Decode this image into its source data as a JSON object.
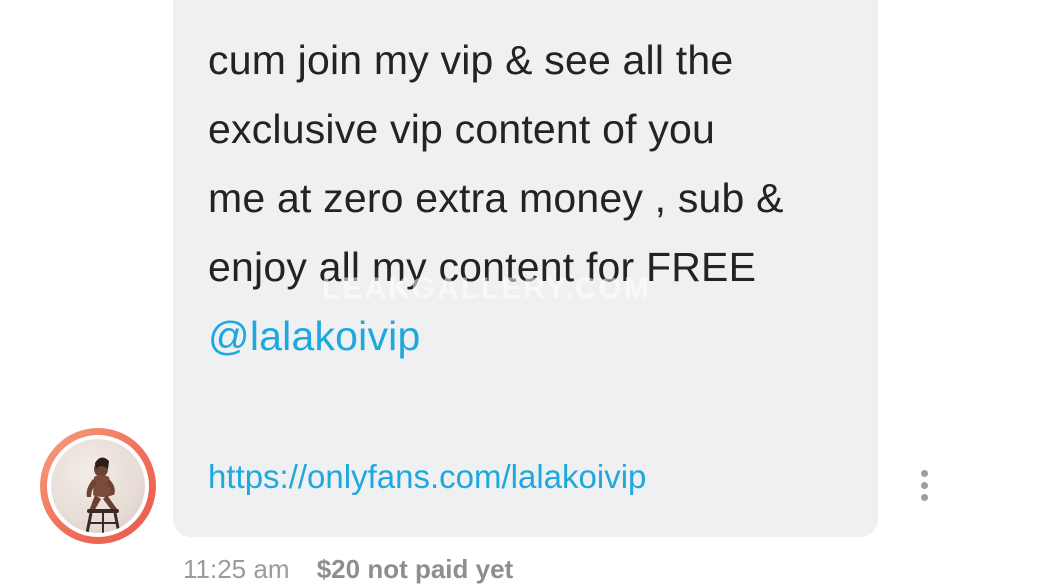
{
  "message": {
    "lines": [
      "cum join my vip & see all the",
      "exclusive vip content of you",
      "me at zero extra money , sub &",
      "enjoy all my content for FREE"
    ],
    "mention": "@lalakoivip",
    "link": "https://onlyfans.com/lalakoivip",
    "watermark": "LEAKGALLERY.COM"
  },
  "meta": {
    "time": "11:25 am",
    "price_status": "$20 not paid yet"
  },
  "icons": {
    "menu": "more-vertical-icon",
    "avatar": "avatar"
  },
  "colors": {
    "bubble": "#eff0f2",
    "text": "#222325",
    "link": "#1fa8de",
    "avatar_ring": "#ef6f5a",
    "meta": "#9a9b9f"
  }
}
